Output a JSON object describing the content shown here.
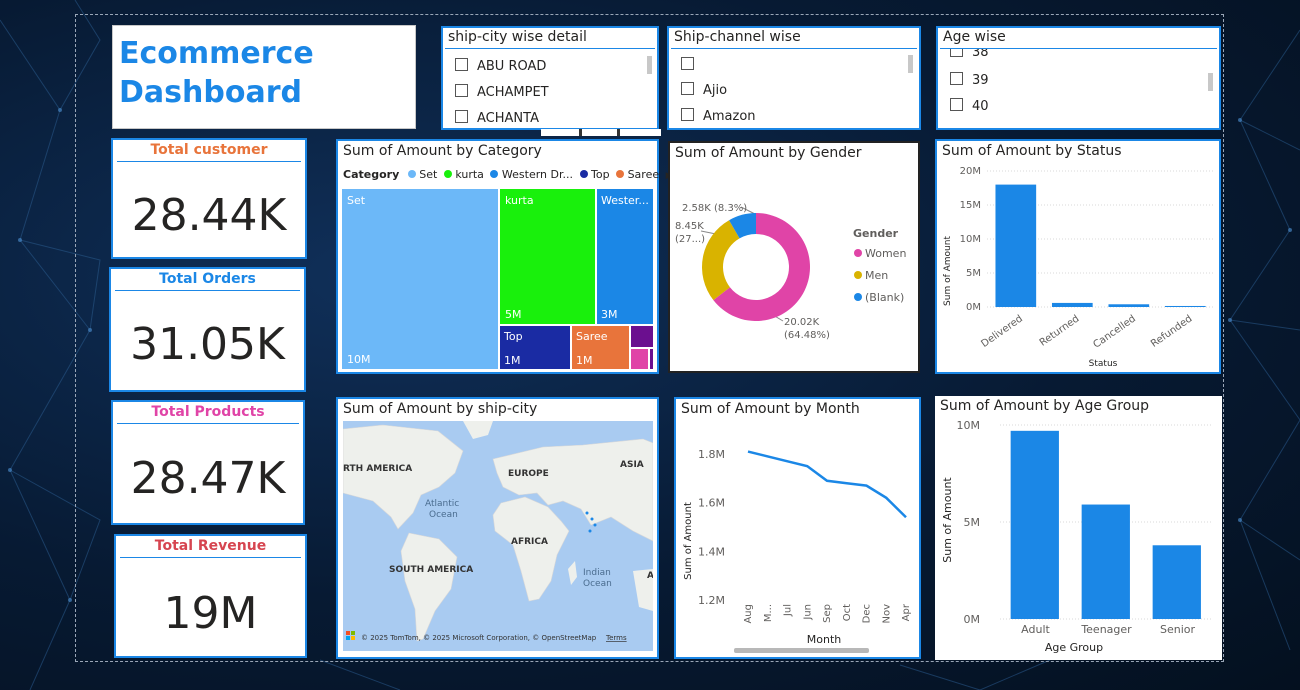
{
  "dashboard": {
    "title_line1": "Ecommerce",
    "title_line2": "Dashboard"
  },
  "kpis": {
    "customers": {
      "label": "Total customer",
      "value": "28.44K",
      "color": "#e8743b"
    },
    "orders": {
      "label": "Total Orders",
      "value": "31.05K",
      "color": "#1b87e6"
    },
    "products": {
      "label": "Total Products",
      "value": "28.47K",
      "color": "#e044a7"
    },
    "revenue": {
      "label": "Total Revenue",
      "value": "19M",
      "color": "#d64550"
    }
  },
  "slicers": {
    "city": {
      "title": "ship-city wise detail",
      "items": [
        "ABU ROAD",
        "ACHAMPET",
        "ACHANTA"
      ]
    },
    "channel": {
      "title": "Ship-channel wise",
      "items": [
        "",
        "Ajio",
        "Amazon"
      ]
    },
    "age": {
      "title": "Age wise",
      "items": [
        "38",
        "39",
        "40"
      ]
    }
  },
  "category_chart": {
    "title": "Sum of Amount by Category",
    "legend_label": "Category",
    "legend": [
      "Set",
      "kurta",
      "Western Dr...",
      "Top",
      "Saree"
    ],
    "tiles": [
      {
        "name": "Set",
        "value_label": "10M",
        "color": "#6cb8f8"
      },
      {
        "name": "kurta",
        "value_label": "5M",
        "color": "#19f00c"
      },
      {
        "name": "Wester...",
        "value_label": "3M",
        "color": "#1b87e6"
      },
      {
        "name": "Top",
        "value_label": "1M",
        "color": "#1a2ba3"
      },
      {
        "name": "Saree",
        "value_label": "1M",
        "color": "#e8743b"
      }
    ]
  },
  "gender_chart": {
    "title": "Sum of Amount by Gender",
    "legend_title": "Gender",
    "callouts": {
      "blank": "2.58K (8.3%)",
      "men_a": "8.45K",
      "men_b": "(27...)",
      "women_a": "20.02K",
      "women_b": "(64.48%)"
    },
    "slices": [
      {
        "name": "Women",
        "value": 20.02,
        "color": "#e044a7"
      },
      {
        "name": "Men",
        "value": 8.45,
        "color": "#d9b300"
      },
      {
        "name": "(Blank)",
        "value": 2.58,
        "color": "#1b87e6"
      }
    ]
  },
  "status_chart": {
    "title": "Sum of Amount by Status",
    "ylabel": "Sum of Amount",
    "xlabel": "Status",
    "yticks": [
      "0M",
      "5M",
      "10M",
      "15M",
      "20M"
    ],
    "categories": [
      "Delivered",
      "Returned",
      "Cancelled",
      "Refunded"
    ],
    "values": [
      18.0,
      0.6,
      0.4,
      0.15
    ],
    "ymax": 20,
    "color": "#1b87e6"
  },
  "map": {
    "title": "Sum of Amount by ship-city",
    "labels": {
      "na": "RTH AMERICA",
      "eu": "EUROPE",
      "asia": "ASIA",
      "atl1": "Atlantic",
      "atl2": "Ocean",
      "af": "AFRICA",
      "sa": "SOUTH AMERICA",
      "ind1": "Indian",
      "ind2": "Ocean",
      "a": "A"
    },
    "attribution": "© 2025 TomTom, © 2025 Microsoft Corporation, © OpenStreetMap",
    "terms": "Terms"
  },
  "month_chart": {
    "title": "Sum of Amount by Month",
    "ylabel": "Sum of Amount",
    "xlabel": "Month",
    "yticks": [
      "1.2M",
      "1.4M",
      "1.6M",
      "1.8M"
    ],
    "categories": [
      "Aug",
      "M...",
      "Jul",
      "Jun",
      "Sep",
      "Oct",
      "Dec",
      "Nov",
      "Apr"
    ],
    "values": [
      1.81,
      1.79,
      1.77,
      1.75,
      1.69,
      1.68,
      1.67,
      1.62,
      1.54
    ],
    "ymin": 1.2,
    "ymax": 1.8,
    "color": "#1b87e6"
  },
  "age_chart": {
    "title": "Sum of Amount by Age Group",
    "ylabel": "Sum of Amount",
    "xlabel": "Age Group",
    "yticks": [
      "0M",
      "5M",
      "10M"
    ],
    "categories": [
      "Adult",
      "Teenager",
      "Senior"
    ],
    "values": [
      9.7,
      5.9,
      3.8
    ],
    "ymax": 10,
    "color": "#1b87e6"
  },
  "chart_data": [
    {
      "type": "bar",
      "title": "Sum of Amount by Status",
      "xlabel": "Status",
      "ylabel": "Sum of Amount",
      "categories": [
        "Delivered",
        "Returned",
        "Cancelled",
        "Refunded"
      ],
      "values": [
        18.0,
        0.6,
        0.4,
        0.15
      ],
      "unit": "M",
      "ylim": [
        0,
        20
      ]
    },
    {
      "type": "line",
      "title": "Sum of Amount by Month",
      "xlabel": "Month",
      "ylabel": "Sum of Amount",
      "categories": [
        "Aug",
        "M...",
        "Jul",
        "Jun",
        "Sep",
        "Oct",
        "Dec",
        "Nov",
        "Apr"
      ],
      "values": [
        1.81,
        1.79,
        1.77,
        1.75,
        1.69,
        1.68,
        1.67,
        1.62,
        1.54
      ],
      "unit": "M"
    },
    {
      "type": "bar",
      "title": "Sum of Amount by Age Group",
      "xlabel": "Age Group",
      "ylabel": "Sum of Amount",
      "categories": [
        "Adult",
        "Teenager",
        "Senior"
      ],
      "values": [
        9.7,
        5.9,
        3.8
      ],
      "unit": "M",
      "ylim": [
        0,
        10
      ]
    },
    {
      "type": "pie",
      "title": "Sum of Amount by Gender",
      "categories": [
        "Women",
        "Men",
        "(Blank)"
      ],
      "values": [
        20.02,
        8.45,
        2.58
      ],
      "unit": "K"
    },
    {
      "type": "heatmap",
      "title": "Sum of Amount by Category",
      "categories": [
        "Set",
        "kurta",
        "Western Dr...",
        "Top",
        "Saree"
      ],
      "values": [
        10,
        5,
        3,
        1,
        1
      ],
      "unit": "M"
    }
  ]
}
